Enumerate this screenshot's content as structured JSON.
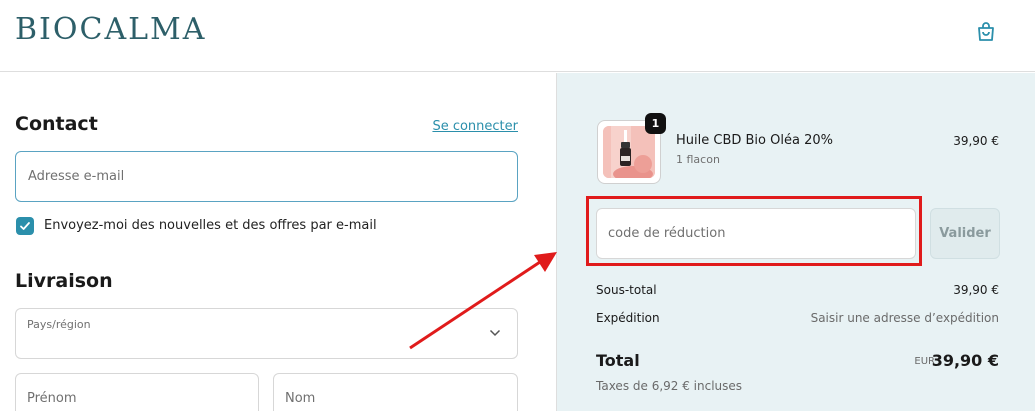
{
  "header": {
    "logo": "BIOCALMA",
    "cart_icon": "shopping-bag-icon"
  },
  "contact": {
    "title": "Contact",
    "login_link": "Se connecter",
    "email_placeholder": "Adresse e-mail",
    "newsletter_checked": true,
    "newsletter_label": "Envoyez-moi des nouvelles et des offres par e-mail"
  },
  "delivery": {
    "title": "Livraison",
    "country_label": "Pays/région",
    "first_name_placeholder": "Prénom",
    "last_name_placeholder": "Nom"
  },
  "cart": {
    "item": {
      "quantity": "1",
      "name": "Huile CBD Bio Oléa 20%",
      "variant": "1 flacon",
      "price": "39,90 €"
    },
    "discount_placeholder": "code de réduction",
    "validate_label": "Valider",
    "subtotal_label": "Sous-total",
    "subtotal_value": "39,90 €",
    "shipping_label": "Expédition",
    "shipping_value": "Saisir une adresse d’expédition",
    "total_label": "Total",
    "currency": "EUR",
    "total_value": "39,90 €",
    "tax_note": "Taxes de 6,92 € incluses"
  },
  "colors": {
    "brand": "#2d5f69",
    "accent": "#2b8fab",
    "summary_bg": "#e8f2f4",
    "highlight": "#e01b1b"
  }
}
